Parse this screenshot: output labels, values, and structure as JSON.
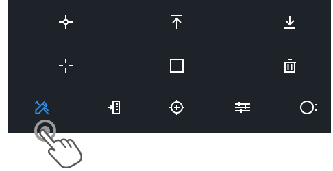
{
  "toolbar": {
    "colors": {
      "background": "#1e2229",
      "icon": "#ffffff",
      "active_icon": "#2f8fea",
      "hint_outline": "#5a5a5a",
      "hint_ring": "#9a9a9a"
    },
    "rows": [
      [
        "add-point-icon",
        "align-top-icon",
        "download-icon"
      ],
      [
        "crosshair-split-icon",
        "square-icon",
        "trash-icon"
      ],
      [
        "draw-tools-icon",
        "import-icon",
        "locate-target-icon",
        "adjust-sliders-icon",
        "layers-toggle-icon"
      ]
    ],
    "active_icon": "draw-tools-icon",
    "gesture_hint": "tap-hand-icon"
  }
}
